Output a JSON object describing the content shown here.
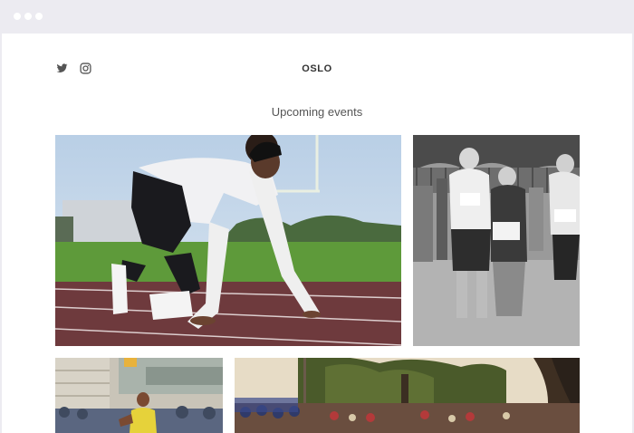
{
  "site": {
    "brand": "OSLO"
  },
  "social": {
    "twitter_icon": "twitter-icon",
    "instagram_icon": "instagram-icon"
  },
  "events": {
    "heading": "Upcoming events"
  },
  "gallery": [
    {
      "image": "sprinter-on-track-photo"
    },
    {
      "image": "marathon-runners-bw-photo"
    },
    {
      "image": "street-runner-photo"
    },
    {
      "image": "park-race-crowd-photo"
    }
  ]
}
